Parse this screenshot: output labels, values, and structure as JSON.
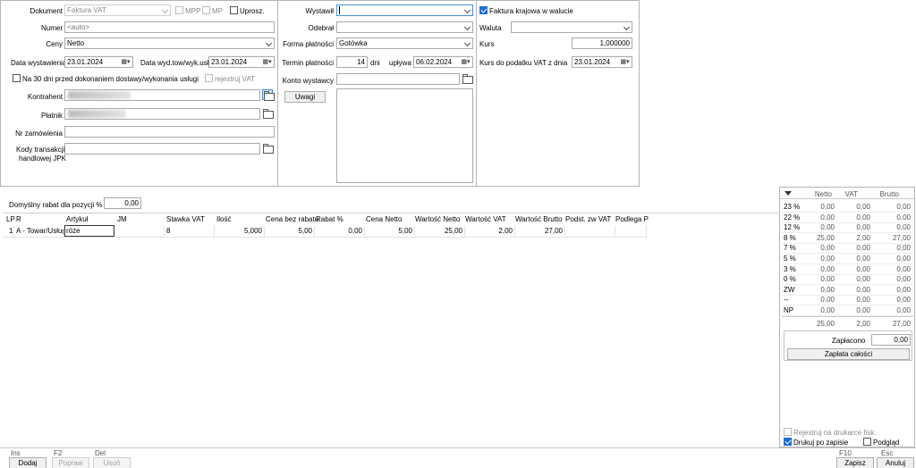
{
  "header": {
    "dokument_label": "Dokument",
    "dokument_value": "Faktura VAT",
    "mpp_label": "MPP",
    "mp_label": "MP",
    "uprosz_label": "Uprosz.",
    "numer_label": "Numer",
    "numer_value": "<auto>",
    "ceny_label": "Ceny",
    "ceny_value": "Netto",
    "data_wyst_label": "Data wystawienia",
    "data_wyst_value": "23.01.2024",
    "data_wyd_label": "Data wyd.tow/wyk.usł.",
    "data_wyd_value": "23.01.2024",
    "na30_label": "Na 30 dni przed dokonaniem dostawy/wykonania usługi",
    "rejestruj_vat_label": "rejestruj VAT",
    "kontrahent_label": "Kontrahent",
    "platnik_label": "Płatnik",
    "nr_zam_label": "Nr zamówienia",
    "kody_label_1": "Kody transakcji",
    "kody_label_2": "handlowej JPK"
  },
  "middle": {
    "wystawil_label": "Wystawił",
    "odebral_label": "Odebrał",
    "forma_label": "Forma płatności",
    "forma_value": "Gotówka",
    "termin_label": "Termin płatności",
    "termin_days": "14",
    "dni_label": "dni",
    "uplywa_label": "upływa",
    "uplywa_value": "06.02.2024",
    "konto_label": "Konto wystawcy",
    "uwagi_button": "Uwagi"
  },
  "right": {
    "faktura_krajowa_label": "Faktura krajowa w walucie",
    "waluta_label": "Waluta",
    "kurs_label": "Kurs",
    "kurs_value": "1,000000",
    "kurs_vat_label": "Kurs do podatku VAT z dnia",
    "kurs_vat_value": "23.01.2024"
  },
  "rabat": {
    "label": "Domyślny rabat dla pozycji %",
    "value": "0,00"
  },
  "grid": {
    "columns": [
      "LP",
      "R",
      "Artykuł",
      "JM",
      "Stawka VAT",
      "Ilość",
      "Cena bez rabatu",
      "Rabat %",
      "Cena Netto",
      "Wartość Netto",
      "Wartość VAT",
      "Wartość Brutto",
      "Podst. zw VAT",
      "Podlega P"
    ],
    "rows": [
      {
        "lp": "1",
        "r": "A - Towar/Usługa",
        "artykul": "róże",
        "jm": "",
        "stawka": "8",
        "ilosc": "5,000",
        "cena_bez": "5,00",
        "rabat": "0,00",
        "cena_netto": "5,00",
        "wart_netto": "25,00",
        "wart_vat": "2,00",
        "wart_brutto": "27,00"
      }
    ]
  },
  "summary": {
    "headers": [
      "Netto",
      "VAT",
      "Brutto"
    ],
    "rows": [
      {
        "rate": "23 %",
        "netto": "0,00",
        "vat": "0,00",
        "brutto": "0,00"
      },
      {
        "rate": "22 %",
        "netto": "0,00",
        "vat": "0,00",
        "brutto": "0,00"
      },
      {
        "rate": "12 %",
        "netto": "0,00",
        "vat": "0,00",
        "brutto": "0,00"
      },
      {
        "rate": "8 %",
        "netto": "25,00",
        "vat": "2,00",
        "brutto": "27,00"
      },
      {
        "rate": "7 %",
        "netto": "0,00",
        "vat": "0,00",
        "brutto": "0,00"
      },
      {
        "rate": "5 %",
        "netto": "0,00",
        "vat": "0,00",
        "brutto": "0,00"
      },
      {
        "rate": "3 %",
        "netto": "0,00",
        "vat": "0,00",
        "brutto": "0,00"
      },
      {
        "rate": "0 %",
        "netto": "0,00",
        "vat": "0,00",
        "brutto": "0,00"
      },
      {
        "rate": "ZW",
        "netto": "0,00",
        "vat": "0,00",
        "brutto": "0,00"
      },
      {
        "rate": "--",
        "netto": "0,00",
        "vat": "0,00",
        "brutto": "0,00"
      },
      {
        "rate": "NP",
        "netto": "0,00",
        "vat": "0,00",
        "brutto": "0,00"
      }
    ],
    "total": {
      "netto": "25,00",
      "vat": "2,00",
      "brutto": "27,00"
    },
    "zaplacono_label": "Zapłacono",
    "zaplacono_value": "0,00",
    "zaplata_calosci_button": "Zapłata całości",
    "rejestruj_fisk_label": "Rejestruj na drukarce fisk.",
    "drukuj_label": "Drukuj po zapisie",
    "podglad_label": "Podgląd"
  },
  "footer": {
    "dodaj_key": "Ins",
    "dodaj": "Dodaj",
    "popraw_key": "F2",
    "popraw": "Popraw",
    "usun_key": "Del",
    "usun": "Usuń",
    "zapisz_key": "F10",
    "zapisz": "Zapisz",
    "anuluj_key": "Esc",
    "anuluj": "Anuluj"
  }
}
